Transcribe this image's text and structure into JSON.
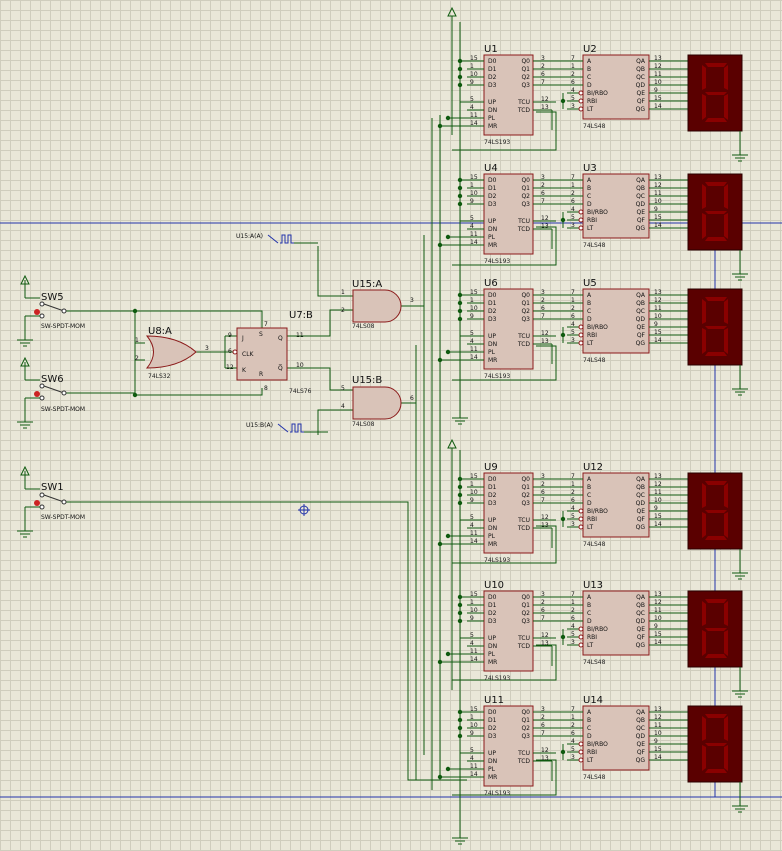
{
  "colors": {
    "wire": "#0f5a0f",
    "body_fill": "#d9c3b8",
    "body_stroke": "#8b1a1a",
    "display_body": "#5a0000",
    "segment": "#8a0000",
    "bus_line": "#2233aa",
    "switch_red": "#cc2222"
  },
  "switches": [
    {
      "ref": "SW5",
      "type": "SW-SPDT-MOM"
    },
    {
      "ref": "SW6",
      "type": "SW-SPDT-MOM"
    },
    {
      "ref": "SW1",
      "type": "SW-SPDT-MOM"
    }
  ],
  "or_gate": {
    "ref": "U8:A",
    "type": "74LS32",
    "pins": [
      "1",
      "2",
      "3"
    ]
  },
  "flipflop": {
    "ref": "U7:B",
    "type": "74LS76",
    "pin_labels": [
      "J",
      "CLK",
      "K",
      "Q",
      "Q̅",
      "S",
      "R"
    ],
    "pin_numbers": [
      "9",
      "6",
      "12",
      "11",
      "10",
      "7",
      "8"
    ]
  },
  "and_gates": [
    {
      "ref": "U15:A",
      "type": "74LS08",
      "pins": [
        "1",
        "2",
        "3"
      ]
    },
    {
      "ref": "U15:B",
      "type": "74LS08",
      "pins": [
        "5",
        "4",
        "6"
      ]
    }
  ],
  "clock_sources": [
    "U15:A(A)",
    "U15:B(A)"
  ],
  "counter_pins": {
    "left_labels": [
      "D0",
      "D1",
      "D2",
      "D3",
      "UP",
      "DN",
      "PL",
      "MR"
    ],
    "left_numbers": [
      "15",
      "1",
      "10",
      "9",
      "5",
      "4",
      "11",
      "14"
    ],
    "right_labels": [
      "Q0",
      "Q1",
      "Q2",
      "Q3",
      "TCU",
      "TCD"
    ],
    "right_numbers": [
      "3",
      "2",
      "6",
      "7",
      "12",
      "13"
    ]
  },
  "decoder_pins": {
    "left_labels": [
      "A",
      "B",
      "C",
      "D",
      "BI/RBO",
      "RBI",
      "LT"
    ],
    "left_numbers": [
      "7",
      "1",
      "2",
      "6",
      "4",
      "5",
      "3"
    ],
    "right_labels": [
      "QA",
      "QB",
      "QC",
      "QD",
      "QE",
      "QF",
      "QG"
    ],
    "right_numbers": [
      "13",
      "12",
      "11",
      "10",
      "9",
      "15",
      "14"
    ]
  },
  "stages": [
    {
      "counter": "U1",
      "counter_type": "74LS193",
      "decoder": "U2",
      "decoder_type": "74LS48"
    },
    {
      "counter": "U4",
      "counter_type": "74LS193",
      "decoder": "U3",
      "decoder_type": "74LS48"
    },
    {
      "counter": "U6",
      "counter_type": "74LS193",
      "decoder": "U5",
      "decoder_type": "74LS48"
    },
    {
      "counter": "U9",
      "counter_type": "74LS193",
      "decoder": "U12",
      "decoder_type": "74LS48"
    },
    {
      "counter": "U10",
      "counter_type": "74LS193",
      "decoder": "U13",
      "decoder_type": "74LS48"
    },
    {
      "counter": "U11",
      "counter_type": "74LS193",
      "decoder": "U14",
      "decoder_type": "74LS48"
    }
  ]
}
